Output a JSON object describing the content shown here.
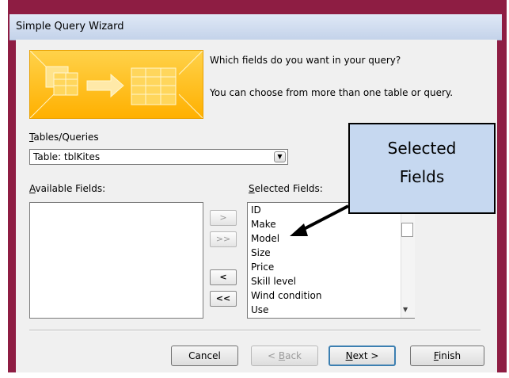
{
  "window": {
    "title": "Simple Query Wizard"
  },
  "prompt": {
    "line1": "Which fields do you want in your query?",
    "line2": "You can choose from more than one table or query."
  },
  "tables": {
    "label_underline": "T",
    "label_rest": "ables/Queries",
    "selected": "Table: tblKites"
  },
  "available": {
    "label_underline": "A",
    "label_rest": "vailable Fields:",
    "items": []
  },
  "selected_fields": {
    "label_underline": "S",
    "label_rest": "elected Fields:",
    "items": [
      "ID",
      "Make",
      "Model",
      "Size",
      "Price",
      "Skill level",
      "Wind condition",
      "Use"
    ]
  },
  "move_buttons": {
    "add_one": ">",
    "add_all": ">>",
    "remove_one": "<",
    "remove_all": "<<"
  },
  "footer": {
    "cancel": "Cancel",
    "back_prefix": "< ",
    "back_underline": "B",
    "back_rest": "ack",
    "next_underline": "N",
    "next_rest": "ext >",
    "finish_underline": "F",
    "finish_rest": "inish"
  },
  "callout": {
    "line1": "Selected",
    "line2": "Fields"
  },
  "colors": {
    "frame": "#8e1d43",
    "banner": "#ffb000",
    "callout_fill": "#c6d8f0"
  },
  "icons": {
    "dropdown": "chevron-down-icon",
    "scroll_down": "scroll-down-icon"
  }
}
